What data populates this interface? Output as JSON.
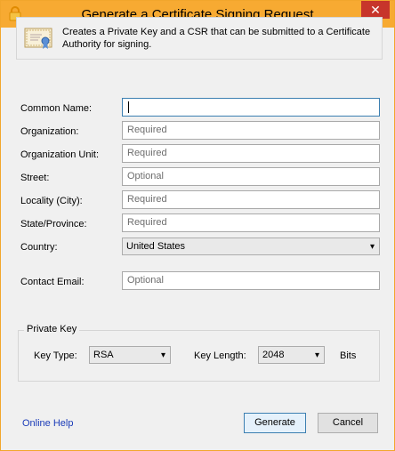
{
  "window": {
    "title": "Generate a Certificate Signing Request",
    "close_glyph": "✕"
  },
  "banner": {
    "text": "Creates a Private Key and a CSR that can be submitted to a Certificate Authority for signing."
  },
  "form": {
    "common_name": {
      "label": "Common Name:",
      "value": ""
    },
    "organization": {
      "label": "Organization:",
      "placeholder": "Required"
    },
    "organization_unit": {
      "label": "Organization Unit:",
      "placeholder": "Required"
    },
    "street": {
      "label": "Street:",
      "placeholder": "Optional"
    },
    "locality": {
      "label": "Locality (City):",
      "placeholder": "Required"
    },
    "state": {
      "label": "State/Province:",
      "placeholder": "Required"
    },
    "country": {
      "label": "Country:",
      "value": "United States"
    },
    "contact_email": {
      "label": "Contact Email:",
      "placeholder": "Optional"
    }
  },
  "private_key": {
    "group_label": "Private Key",
    "key_type_label": "Key Type:",
    "key_type_value": "RSA",
    "key_length_label": "Key Length:",
    "key_length_value": "2048",
    "bits_label": "Bits"
  },
  "footer": {
    "help_link": "Online Help",
    "generate_label": "Generate",
    "cancel_label": "Cancel"
  },
  "colors": {
    "titlebar": "#f7aa32",
    "close": "#c7352b",
    "link": "#1a3bb8",
    "focus": "#3c7fb1"
  },
  "icons": {
    "title": "lock-icon",
    "banner": "certificate-icon",
    "dropdown": "chevron-down-icon"
  }
}
